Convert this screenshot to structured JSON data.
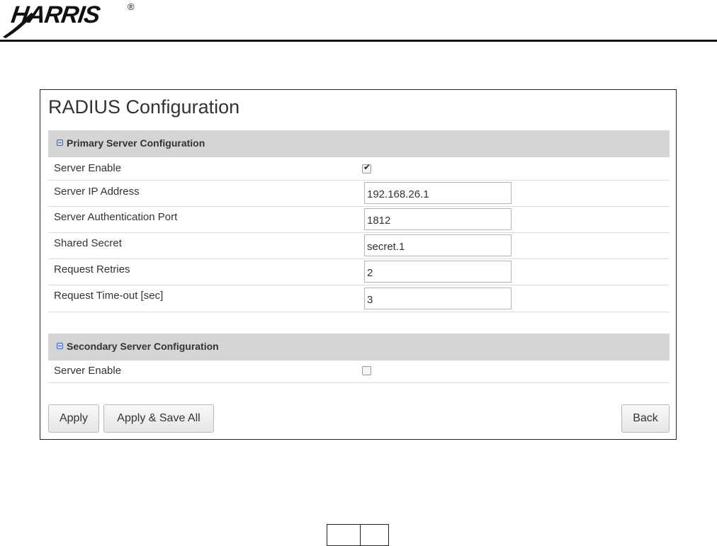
{
  "header": {
    "logo_text": "HARRIS",
    "logo_mark": "®"
  },
  "panel": {
    "title": "RADIUS Configuration",
    "primary": {
      "label": "Primary Server Configuration",
      "server_enable": {
        "label": "Server Enable",
        "checked": true
      },
      "fields": [
        {
          "label": "Server IP Address",
          "value": "192.168.26.1"
        },
        {
          "label": "Server Authentication Port",
          "value": "1812"
        },
        {
          "label": "Shared Secret",
          "value": "secret.1"
        },
        {
          "label": "Request Retries",
          "value": "2"
        },
        {
          "label": "Request Time-out [sec]",
          "value": "3"
        }
      ]
    },
    "secondary": {
      "label": "Secondary Server Configuration",
      "server_enable": {
        "label": "Server Enable",
        "checked": false
      }
    },
    "buttons": {
      "apply": "Apply",
      "apply_save_all": "Apply & Save All",
      "back": "Back"
    }
  },
  "icons": {
    "collapse": "collapse-minus-icon",
    "check": "check-icon"
  }
}
